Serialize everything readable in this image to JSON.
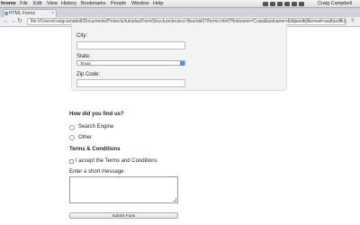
{
  "menubar": {
    "app": "hrome",
    "items": [
      "File",
      "Edit",
      "View",
      "History",
      "Bookmarks",
      "People",
      "Window",
      "Help"
    ],
    "user": "Craig Campbell"
  },
  "browser": {
    "tab_title": "HTML Forms",
    "url": "file:///Users/craigcampbell/Documents/Projects/tutsplus/FormStructure/project-files/obj07/forms.html?firstname=Craig&lastname=&ldjaisdkjf&email=asdfasdfk@..."
  },
  "form": {
    "city_label": "City:",
    "state_label": "State:",
    "state_value": "Texas",
    "zip_label": "Zip Code:",
    "find_heading": "How did you find us?",
    "radio_search": "Search Engine",
    "radio_other": "Other",
    "terms_heading": "Terms & Conditions",
    "terms_checkbox": "I accept the Terms and Conditions",
    "message_label": "Enter a short message:",
    "submit_label": "Submit Form"
  }
}
